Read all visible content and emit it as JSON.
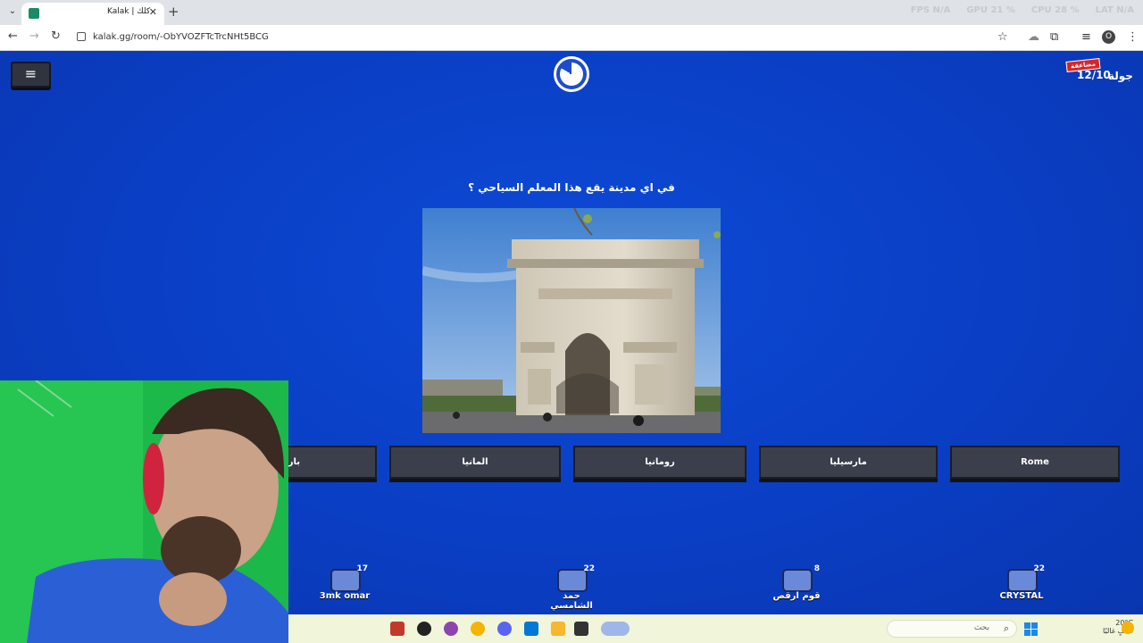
{
  "browser": {
    "tab_title": "Kalak | كلك",
    "url": "kalak.gg/room/-ObYVOZFTcTrcNHt5BCG",
    "perf": [
      {
        "label": "FPS",
        "value": "N/A"
      },
      {
        "label": "GPU",
        "value": "21 %"
      },
      {
        "label": "CPU",
        "value": "28 %"
      },
      {
        "label": "LAT",
        "value": "N/A"
      }
    ]
  },
  "game": {
    "round_badge": "مضاعفة",
    "round_value": "12/10",
    "round_label": "جولة",
    "question": "في اي مدينة يقع هذا المعلم السياحي ؟",
    "answers": [
      "باريس",
      "المانيا",
      "رومانيا",
      "مارسيليا",
      "Rome"
    ],
    "players": [
      {
        "name": "3mk omar",
        "score": "17"
      },
      {
        "name": "حمد الشامسي",
        "score": "22"
      },
      {
        "name": "قوم ارقص",
        "score": "8"
      },
      {
        "name": "CRYSTAL",
        "score": "22"
      }
    ]
  },
  "taskbar": {
    "search_placeholder": "بحث",
    "weather_temp": "20°C",
    "weather_desc": "صافٍ غالبًا"
  },
  "colors": {
    "game_bg": "#0b3fc4",
    "answer_bg": "#3b3f4c",
    "badge_red": "#d8232a",
    "taskbar_bg": "#f1f5da"
  }
}
